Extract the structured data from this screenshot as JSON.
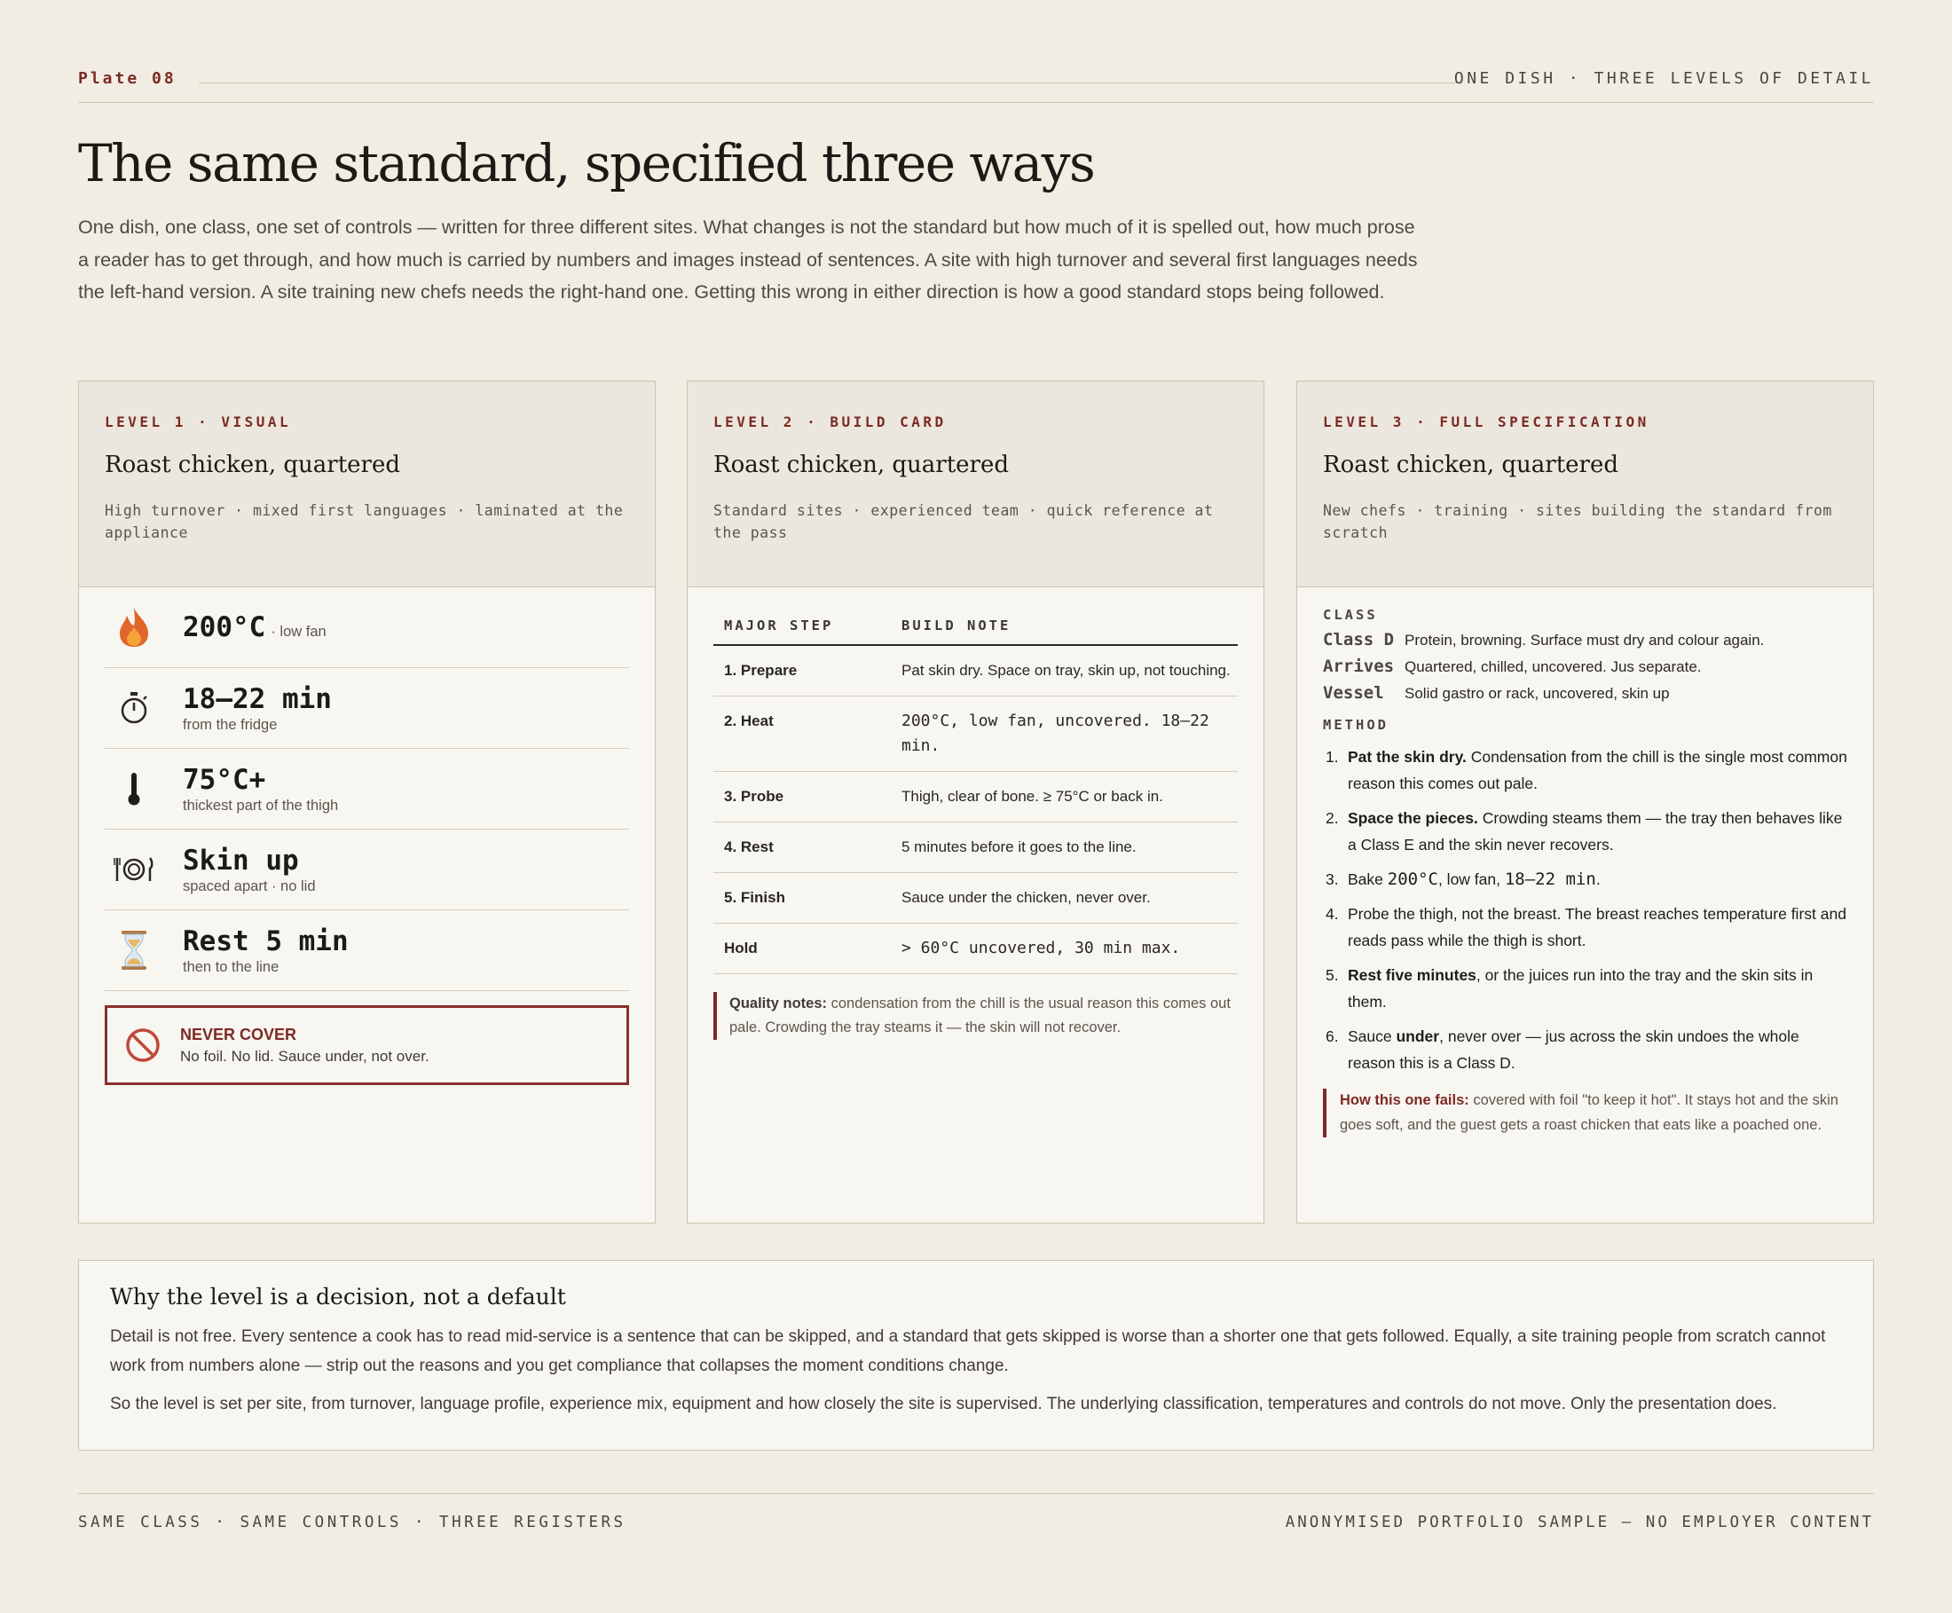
{
  "header": {
    "plate": "Plate 08",
    "tag": "ONE DISH · THREE LEVELS OF DETAIL"
  },
  "title": "The same standard, specified three ways",
  "intro": "One dish, one class, one set of controls — written for three different sites. What changes is not the standard but how much of it is spelled out, how much prose a reader has to get through, and how much is carried by numbers and images instead of sentences. A site with high turnover and several first languages needs the left-hand version. A site training new chefs needs the right-hand one. Getting this wrong in either direction is how a good standard stops being followed.",
  "level1": {
    "eyebrow": "LEVEL 1 · VISUAL",
    "title": "Roast chicken, quartered",
    "subtitle": "High turnover · mixed first languages · laminated at the appliance",
    "rows": [
      {
        "icon": "fire-icon",
        "big": "200°C",
        "small": "· low fan"
      },
      {
        "icon": "stopwatch-icon",
        "big": "18–22 min",
        "small": "from the fridge"
      },
      {
        "icon": "thermometer-icon",
        "big": "75°C+",
        "small": "thickest part of the thigh"
      },
      {
        "icon": "plate-cutlery-icon",
        "big": "Skin up",
        "small": "spaced apart · no lid"
      },
      {
        "icon": "hourglass-icon",
        "big": "Rest 5 min",
        "small": "then to the line"
      }
    ],
    "warning": {
      "icon": "prohibited-icon",
      "heading": "NEVER COVER",
      "body": "No foil. No lid. Sauce under, not over."
    }
  },
  "level2": {
    "eyebrow": "LEVEL 2 · BUILD CARD",
    "title": "Roast chicken, quartered",
    "subtitle": "Standard sites · experienced team · quick reference at the pass",
    "columns": [
      "MAJOR STEP",
      "BUILD NOTE"
    ],
    "rows": [
      {
        "step": "1. Prepare",
        "note": "Pat skin dry. Space on tray, skin up, not touching."
      },
      {
        "step": "2. Heat",
        "note": "200°C, low fan, uncovered. 18–22 min."
      },
      {
        "step": "3. Probe",
        "note": "Thigh, clear of bone. ≥ 75°C or back in."
      },
      {
        "step": "4. Rest",
        "note": "5 minutes before it goes to the line."
      },
      {
        "step": "5. Finish",
        "note": "Sauce under the chicken, never over."
      },
      {
        "step": "Hold",
        "note": "> 60°C uncovered, 30 min max."
      }
    ],
    "quality_label": "Quality notes:",
    "quality_text": "condensation from the chill is the usual reason this comes out pale. Crowding the tray steams it — the skin will not recover."
  },
  "level3": {
    "eyebrow": "LEVEL 3 · FULL SPECIFICATION",
    "title": "Roast chicken, quartered",
    "subtitle": "New chefs · training · sites building the standard from scratch",
    "class_label": "CLASS",
    "class_rows": [
      {
        "key": "Class D",
        "value": "Protein, browning. Surface must dry and colour again."
      },
      {
        "key": "Arrives",
        "value": "Quartered, chilled, uncovered. Jus separate."
      },
      {
        "key": "Vessel",
        "value": "Solid gastro or rack, uncovered, skin up"
      }
    ],
    "method_label": "METHOD",
    "method": {
      "s1": {
        "n": "1.",
        "bold": "Pat the skin dry.",
        "text": " Condensation from the chill is the single most common reason this comes out pale."
      },
      "s2": {
        "n": "2.",
        "bold": "Space the pieces.",
        "text": " Crowding steams them — the tray then behaves like a Class E and the skin never recovers."
      },
      "s3": {
        "n": "3.",
        "a": "Bake ",
        "m1": "200°C",
        "b": ", low fan, ",
        "m2": "18–22 min",
        "c": "."
      },
      "s4": {
        "n": "4.",
        "text": "Probe the thigh, not the breast. The breast reaches temperature first and reads pass while the thigh is short."
      },
      "s5": {
        "n": "5.",
        "bold": "Rest five minutes",
        "text": ", or the juices run into the tray and the skin sits in them."
      },
      "s6": {
        "n": "6.",
        "a": "Sauce ",
        "bold": "under",
        "b": ", never over — jus across the skin undoes the whole reason this is a Class D."
      }
    },
    "fails_label": "How this one fails:",
    "fails_text": "covered with foil \"to keep it hot\". It stays hot and the skin goes soft, and the guest gets a roast chicken that eats like a poached one."
  },
  "why": {
    "heading": "Why the level is a decision, not a default",
    "p1": "Detail is not free. Every sentence a cook has to read mid-service is a sentence that can be skipped, and a standard that gets skipped is worse than a shorter one that gets followed. Equally, a site training people from scratch cannot work from numbers alone — strip out the reasons and you get compliance that collapses the moment conditions change.",
    "p2": "So the level is set per site, from turnover, language profile, experience mix, equipment and how closely the site is supervised. The underlying classification, temperatures and controls do not move. Only the presentation does."
  },
  "footer": {
    "left": "SAME CLASS · SAME CONTROLS · THREE REGISTERS",
    "right": "ANONYMISED PORTFOLIO SAMPLE — NO EMPLOYER CONTENT"
  }
}
